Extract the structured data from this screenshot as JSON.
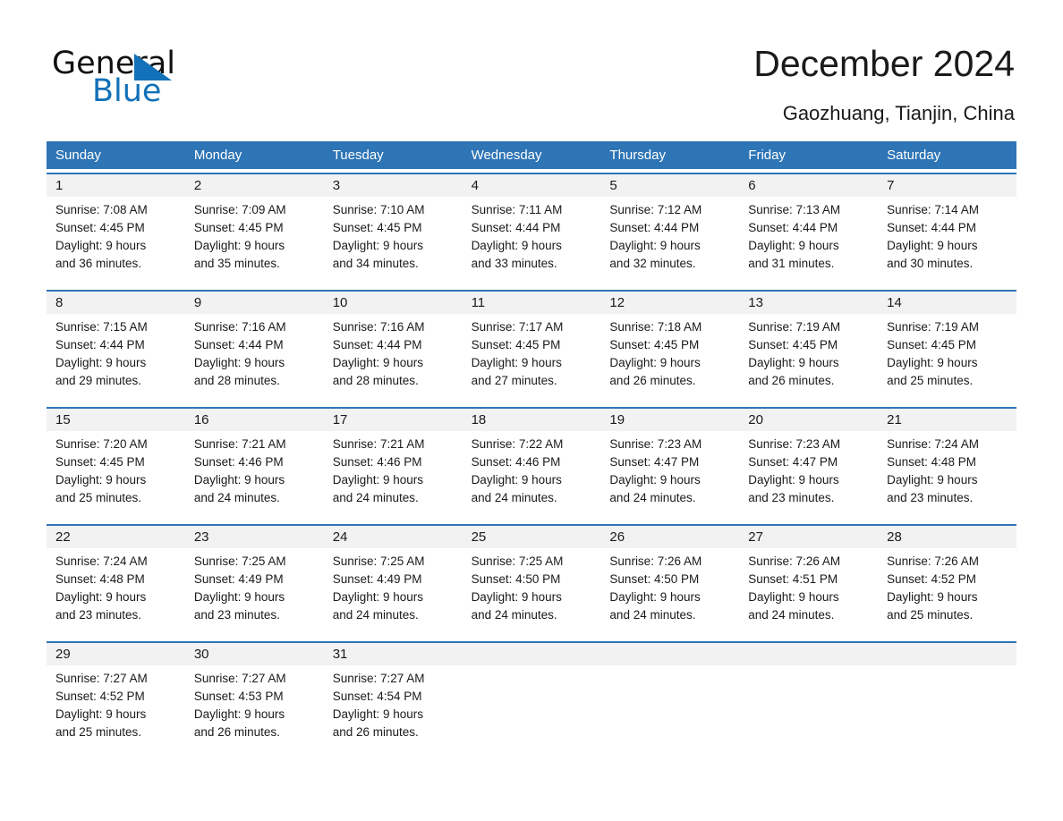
{
  "brand": {
    "name_part1": "General",
    "name_part2": "Blue",
    "triangle_color": "#1271b8"
  },
  "header": {
    "title": "December 2024",
    "location": "Gaozhuang, Tianjin, China"
  },
  "theme": {
    "header_blue": "#2e75b6",
    "day_band_gray": "#f2f2f2",
    "text": "#1a1a1a"
  },
  "weekdays": [
    "Sunday",
    "Monday",
    "Tuesday",
    "Wednesday",
    "Thursday",
    "Friday",
    "Saturday"
  ],
  "weeks": [
    {
      "days": [
        {
          "num": "1",
          "l1": "Sunrise: 7:08 AM",
          "l2": "Sunset: 4:45 PM",
          "l3": "Daylight: 9 hours",
          "l4": "and 36 minutes."
        },
        {
          "num": "2",
          "l1": "Sunrise: 7:09 AM",
          "l2": "Sunset: 4:45 PM",
          "l3": "Daylight: 9 hours",
          "l4": "and 35 minutes."
        },
        {
          "num": "3",
          "l1": "Sunrise: 7:10 AM",
          "l2": "Sunset: 4:45 PM",
          "l3": "Daylight: 9 hours",
          "l4": "and 34 minutes."
        },
        {
          "num": "4",
          "l1": "Sunrise: 7:11 AM",
          "l2": "Sunset: 4:44 PM",
          "l3": "Daylight: 9 hours",
          "l4": "and 33 minutes."
        },
        {
          "num": "5",
          "l1": "Sunrise: 7:12 AM",
          "l2": "Sunset: 4:44 PM",
          "l3": "Daylight: 9 hours",
          "l4": "and 32 minutes."
        },
        {
          "num": "6",
          "l1": "Sunrise: 7:13 AM",
          "l2": "Sunset: 4:44 PM",
          "l3": "Daylight: 9 hours",
          "l4": "and 31 minutes."
        },
        {
          "num": "7",
          "l1": "Sunrise: 7:14 AM",
          "l2": "Sunset: 4:44 PM",
          "l3": "Daylight: 9 hours",
          "l4": "and 30 minutes."
        }
      ]
    },
    {
      "days": [
        {
          "num": "8",
          "l1": "Sunrise: 7:15 AM",
          "l2": "Sunset: 4:44 PM",
          "l3": "Daylight: 9 hours",
          "l4": "and 29 minutes."
        },
        {
          "num": "9",
          "l1": "Sunrise: 7:16 AM",
          "l2": "Sunset: 4:44 PM",
          "l3": "Daylight: 9 hours",
          "l4": "and 28 minutes."
        },
        {
          "num": "10",
          "l1": "Sunrise: 7:16 AM",
          "l2": "Sunset: 4:44 PM",
          "l3": "Daylight: 9 hours",
          "l4": "and 28 minutes."
        },
        {
          "num": "11",
          "l1": "Sunrise: 7:17 AM",
          "l2": "Sunset: 4:45 PM",
          "l3": "Daylight: 9 hours",
          "l4": "and 27 minutes."
        },
        {
          "num": "12",
          "l1": "Sunrise: 7:18 AM",
          "l2": "Sunset: 4:45 PM",
          "l3": "Daylight: 9 hours",
          "l4": "and 26 minutes."
        },
        {
          "num": "13",
          "l1": "Sunrise: 7:19 AM",
          "l2": "Sunset: 4:45 PM",
          "l3": "Daylight: 9 hours",
          "l4": "and 26 minutes."
        },
        {
          "num": "14",
          "l1": "Sunrise: 7:19 AM",
          "l2": "Sunset: 4:45 PM",
          "l3": "Daylight: 9 hours",
          "l4": "and 25 minutes."
        }
      ]
    },
    {
      "days": [
        {
          "num": "15",
          "l1": "Sunrise: 7:20 AM",
          "l2": "Sunset: 4:45 PM",
          "l3": "Daylight: 9 hours",
          "l4": "and 25 minutes."
        },
        {
          "num": "16",
          "l1": "Sunrise: 7:21 AM",
          "l2": "Sunset: 4:46 PM",
          "l3": "Daylight: 9 hours",
          "l4": "and 24 minutes."
        },
        {
          "num": "17",
          "l1": "Sunrise: 7:21 AM",
          "l2": "Sunset: 4:46 PM",
          "l3": "Daylight: 9 hours",
          "l4": "and 24 minutes."
        },
        {
          "num": "18",
          "l1": "Sunrise: 7:22 AM",
          "l2": "Sunset: 4:46 PM",
          "l3": "Daylight: 9 hours",
          "l4": "and 24 minutes."
        },
        {
          "num": "19",
          "l1": "Sunrise: 7:23 AM",
          "l2": "Sunset: 4:47 PM",
          "l3": "Daylight: 9 hours",
          "l4": "and 24 minutes."
        },
        {
          "num": "20",
          "l1": "Sunrise: 7:23 AM",
          "l2": "Sunset: 4:47 PM",
          "l3": "Daylight: 9 hours",
          "l4": "and 23 minutes."
        },
        {
          "num": "21",
          "l1": "Sunrise: 7:24 AM",
          "l2": "Sunset: 4:48 PM",
          "l3": "Daylight: 9 hours",
          "l4": "and 23 minutes."
        }
      ]
    },
    {
      "days": [
        {
          "num": "22",
          "l1": "Sunrise: 7:24 AM",
          "l2": "Sunset: 4:48 PM",
          "l3": "Daylight: 9 hours",
          "l4": "and 23 minutes."
        },
        {
          "num": "23",
          "l1": "Sunrise: 7:25 AM",
          "l2": "Sunset: 4:49 PM",
          "l3": "Daylight: 9 hours",
          "l4": "and 23 minutes."
        },
        {
          "num": "24",
          "l1": "Sunrise: 7:25 AM",
          "l2": "Sunset: 4:49 PM",
          "l3": "Daylight: 9 hours",
          "l4": "and 24 minutes."
        },
        {
          "num": "25",
          "l1": "Sunrise: 7:25 AM",
          "l2": "Sunset: 4:50 PM",
          "l3": "Daylight: 9 hours",
          "l4": "and 24 minutes."
        },
        {
          "num": "26",
          "l1": "Sunrise: 7:26 AM",
          "l2": "Sunset: 4:50 PM",
          "l3": "Daylight: 9 hours",
          "l4": "and 24 minutes."
        },
        {
          "num": "27",
          "l1": "Sunrise: 7:26 AM",
          "l2": "Sunset: 4:51 PM",
          "l3": "Daylight: 9 hours",
          "l4": "and 24 minutes."
        },
        {
          "num": "28",
          "l1": "Sunrise: 7:26 AM",
          "l2": "Sunset: 4:52 PM",
          "l3": "Daylight: 9 hours",
          "l4": "and 25 minutes."
        }
      ]
    },
    {
      "days": [
        {
          "num": "29",
          "l1": "Sunrise: 7:27 AM",
          "l2": "Sunset: 4:52 PM",
          "l3": "Daylight: 9 hours",
          "l4": "and 25 minutes."
        },
        {
          "num": "30",
          "l1": "Sunrise: 7:27 AM",
          "l2": "Sunset: 4:53 PM",
          "l3": "Daylight: 9 hours",
          "l4": "and 26 minutes."
        },
        {
          "num": "31",
          "l1": "Sunrise: 7:27 AM",
          "l2": "Sunset: 4:54 PM",
          "l3": "Daylight: 9 hours",
          "l4": "and 26 minutes."
        },
        {
          "num": "",
          "l1": "",
          "l2": "",
          "l3": "",
          "l4": ""
        },
        {
          "num": "",
          "l1": "",
          "l2": "",
          "l3": "",
          "l4": ""
        },
        {
          "num": "",
          "l1": "",
          "l2": "",
          "l3": "",
          "l4": ""
        },
        {
          "num": "",
          "l1": "",
          "l2": "",
          "l3": "",
          "l4": ""
        }
      ]
    }
  ]
}
